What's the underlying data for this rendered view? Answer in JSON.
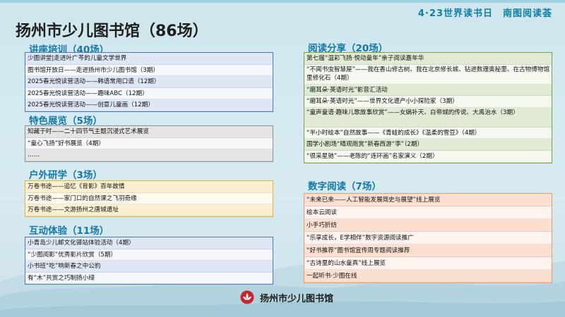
{
  "header": {
    "top_right": "4·23世界读书日　南图阅读荟",
    "title": "扬州市少儿图书馆（86场）"
  },
  "sections": {
    "lectures": {
      "title": "讲座培训（40场）",
      "items": [
        "少图讲堂|走进叶广芩的儿童文学世界",
        "图书馆开放日——走进扬州市少儿图书馆（3期）",
        "2025春光悦读营活动——韩语常用口语（12期）",
        "2025春光悦读营活动——趣味ABC（12期）",
        "2025春光悦读营活动——创意儿童画（12期）"
      ]
    },
    "exhibitions": {
      "title": "特色展览（5场）",
      "items": [
        "知藏于时——二十四节气主题沉浸式艺术展览",
        "“童心飞扬”好书展览（4期）",
        "……"
      ]
    },
    "outdoor": {
      "title": "户外研学（3场）",
      "items": [
        "万卷书途——追忆《背影》百年故情",
        "万卷书途——家门口的自然课之飞羽奇缘",
        "万卷书途——文游扬州之唐城遗址"
      ]
    },
    "interactive": {
      "title": "互动体验（11场）",
      "items": [
        "小青岛少儿邮文化驿站体验活动（4期）",
        "“少图阅影”优秀影片欣赏（5期）",
        "小书班“吃”响新春之中公豹",
        "有“木”共赏之巧制扬小绿"
      ]
    },
    "sharing": {
      "title": "阅读分享（20场）",
      "items": [
        "第七届“温彩飞扬·悦动童年”亲子阅读嘉年华",
        "“不闻书虫智慧屋”——我在香山修古树、我在北京修长城、钻进数理奥秘里、在古物博物馆里修化石（4期）",
        "“磨耳朵·英语时光”影音汇活动",
        "“磨耳朵·英语时光”——世界文化遗产小小探险家（3期）",
        "“童声童语·趣味儿歌故事欣赏”——女娲补天、白帝城的传说、大禹治水（3期）",
        "“半小时绘本”自然故事——《青蛙的成长》《温柔的雪豆》（4期）",
        "国学小剧场“晴观雨赏”新春西游“李”（2期）",
        "“很采星驰”——老陈的“连环画”名家演义（2期）"
      ]
    },
    "digital": {
      "title": "数字阅读（7场）",
      "items": [
        "“未来已来——人工智能发展简史与展望”线上展览",
        "绘本云阅读",
        "小手巧折纺",
        "“乐享成长，E学相伴”数字资源阅读推广",
        "“好书推荐”图书馆宣传周专题阅读推荐",
        "“古诗里的山水童真”线上展览",
        "一起听书·少图在线"
      ]
    }
  },
  "footer": {
    "logo_text": "扬州市少儿图书馆",
    "logo_icon": "lotus-icon"
  },
  "colors": {
    "title_blue": "#1679a6",
    "panel_blue": "#4d78c4",
    "panel_gray": "#8f8f8f",
    "panel_gold": "#e6b43a",
    "panel_orange": "#ee9b6d",
    "panel_green": "#7ea04a",
    "logo_red": "#c8242b"
  }
}
